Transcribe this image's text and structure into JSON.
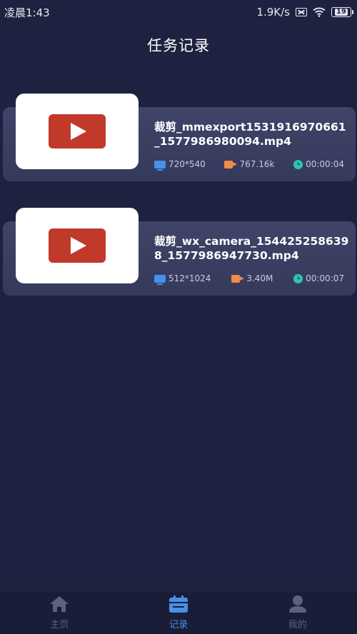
{
  "status_bar": {
    "time": "凌晨1:43",
    "net_speed": "1.9K/s",
    "battery": "19"
  },
  "header": {
    "title": "任务记录"
  },
  "records": [
    {
      "file_name": "裁剪_mmexport1531916970661_1577986980094.mp4",
      "resolution": "720*540",
      "size": "767.16k",
      "duration": "00:00:04"
    },
    {
      "file_name": "裁剪_wx_camera_1544252586398_1577986947730.mp4",
      "resolution": "512*1024",
      "size": "3.40M",
      "duration": "00:00:07"
    }
  ],
  "tab_bar": {
    "home": "主页",
    "records": "记录",
    "mine": "我的",
    "active_tab": "records"
  },
  "colors": {
    "background": "#1e2140",
    "card": "#3f4468",
    "accent": "#4a8fe8",
    "play_red": "#c0392b",
    "size_icon": "#f08a4b",
    "duration_icon": "#2ec4b6"
  }
}
